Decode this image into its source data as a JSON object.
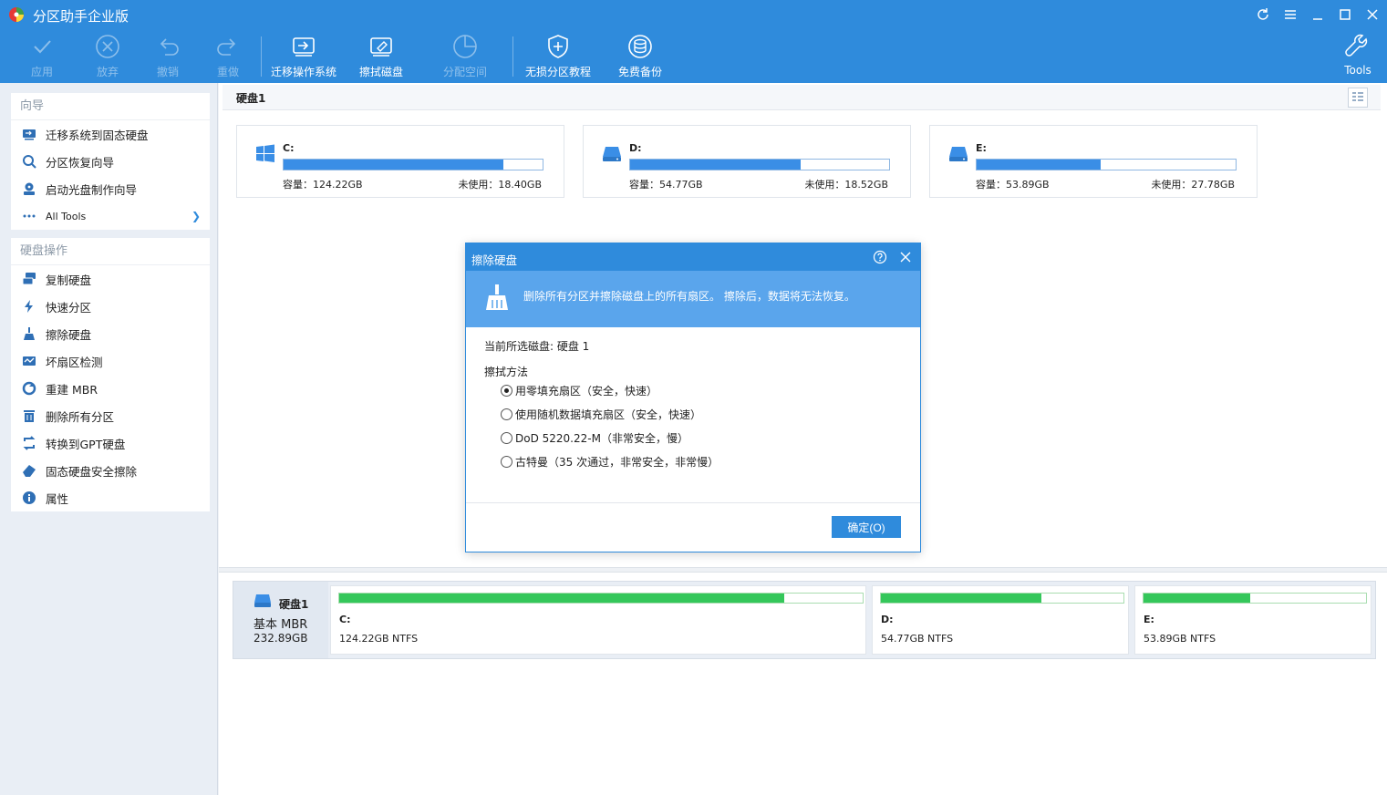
{
  "app": {
    "title": "分区助手企业版"
  },
  "toolbar": {
    "apply": "应用",
    "discard": "放弃",
    "undo": "撤销",
    "redo": "重做",
    "migrate_os": "迁移操作系统",
    "wipe_disk": "擦拭磁盘",
    "allocate_space": "分配空间",
    "lossless_tutorial": "无损分区教程",
    "free_backup": "免费备份",
    "tools": "Tools"
  },
  "sidebar": {
    "wizard_head": "向导",
    "wizard_items": [
      {
        "label": "迁移系统到固态硬盘",
        "icon": "migrate-icon"
      },
      {
        "label": "分区恢复向导",
        "icon": "recovery-icon"
      },
      {
        "label": "启动光盘制作向导",
        "icon": "bootable-media-icon"
      },
      {
        "label": "All Tools",
        "icon": "more-icon"
      }
    ],
    "disk_ops_head": "硬盘操作",
    "disk_ops_items": [
      {
        "label": "复制硬盘",
        "icon": "copy-disk-icon"
      },
      {
        "label": "快速分区",
        "icon": "quick-partition-icon"
      },
      {
        "label": "擦除硬盘",
        "icon": "wipe-icon"
      },
      {
        "label": "坏扇区检测",
        "icon": "bad-sector-icon"
      },
      {
        "label": "重建 MBR",
        "icon": "rebuild-mbr-icon"
      },
      {
        "label": "删除所有分区",
        "icon": "delete-partitions-icon"
      },
      {
        "label": "转换到GPT硬盘",
        "icon": "convert-gpt-icon"
      },
      {
        "label": "固态硬盘安全擦除",
        "icon": "ssd-erase-icon"
      },
      {
        "label": "属性",
        "icon": "info-icon"
      }
    ]
  },
  "main": {
    "disk_tab": "硬盘1",
    "partitions": [
      {
        "letter": "C:",
        "capacity": "容量：124.22GB",
        "free": "未使用：18.40GB",
        "used_fraction": 0.85,
        "icon": "windows-icon"
      },
      {
        "letter": "D:",
        "capacity": "容量：54.77GB",
        "free": "未使用：18.52GB",
        "used_fraction": 0.66,
        "icon": "drive-icon"
      },
      {
        "letter": "E:",
        "capacity": "容量：53.89GB",
        "free": "未使用：27.78GB",
        "used_fraction": 0.48,
        "icon": "drive-icon"
      }
    ],
    "disk_row": {
      "name": "硬盘1",
      "type": "基本 MBR",
      "size": "232.89GB",
      "parts": [
        {
          "letter": "C:",
          "detail": "124.22GB NTFS",
          "used_fraction": 0.85
        },
        {
          "letter": "D:",
          "detail": "54.77GB NTFS",
          "used_fraction": 0.66
        },
        {
          "letter": "E:",
          "detail": "53.89GB NTFS",
          "used_fraction": 0.48
        }
      ]
    }
  },
  "dialog": {
    "title": "擦除硬盘",
    "banner": "删除所有分区并擦除磁盘上的所有扇区。 擦除后，数据将无法恢复。",
    "current_disk": "当前所选磁盘: 硬盘 1",
    "method_label": "擦拭方法",
    "options": [
      {
        "label": "用零填充扇区（安全，快速）",
        "selected": true
      },
      {
        "label": "使用随机数据填充扇区（安全，快速）",
        "selected": false
      },
      {
        "label": "DoD 5220.22-M（非常安全，慢）",
        "selected": false
      },
      {
        "label": "古特曼（35 次通过，非常安全，非常慢）",
        "selected": false
      }
    ],
    "ok": "确定(O)"
  },
  "colors": {
    "accent": "#2f8bdc",
    "banner": "#5aa5ec",
    "used_bar": "#3a8ee6",
    "disk_bar": "#34c75a"
  }
}
